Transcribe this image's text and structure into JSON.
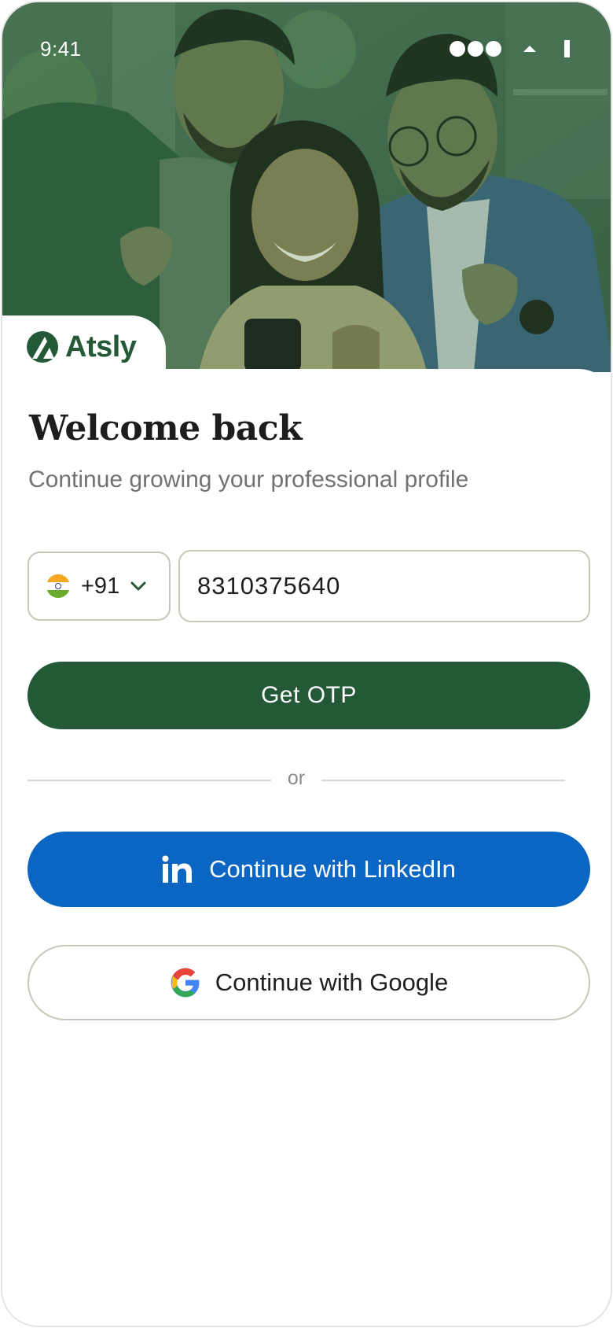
{
  "status_bar": {
    "time": "9:41"
  },
  "brand": {
    "name": "Atsly",
    "color": "#245937"
  },
  "header": {
    "title": "Welcome back",
    "subtitle": "Continue growing your professional profile"
  },
  "phone_form": {
    "country_code": "+91",
    "country_flag": "india-flag-icon",
    "phone_value": "8310375640"
  },
  "actions": {
    "otp_label": "Get OTP",
    "divider_text": "or",
    "linkedin_label": "Continue with LinkedIn",
    "linkedin_color": "#0a66c2",
    "google_label": "Continue with Google"
  },
  "hero": {
    "icon": "hero-photo"
  }
}
